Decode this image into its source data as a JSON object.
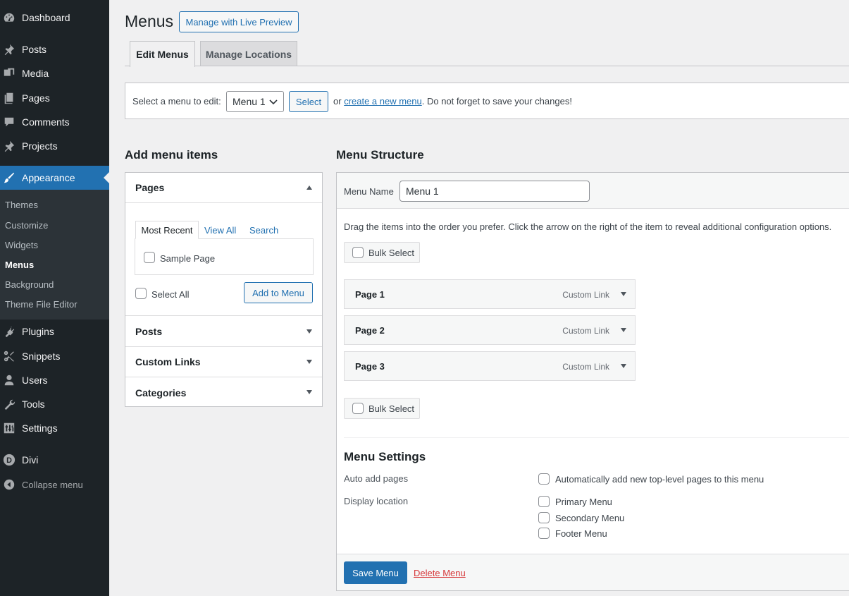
{
  "sidebar": {
    "items": [
      {
        "label": "Dashboard",
        "icon": "dashboard-icon"
      },
      {
        "label": "Posts",
        "icon": "pin-icon"
      },
      {
        "label": "Media",
        "icon": "media-icon"
      },
      {
        "label": "Pages",
        "icon": "pages-icon"
      },
      {
        "label": "Comments",
        "icon": "comment-icon"
      },
      {
        "label": "Projects",
        "icon": "pin-icon"
      },
      {
        "label": "Appearance",
        "icon": "brush-icon"
      },
      {
        "label": "Plugins",
        "icon": "plugin-icon"
      },
      {
        "label": "Snippets",
        "icon": "scissors-icon"
      },
      {
        "label": "Users",
        "icon": "user-icon"
      },
      {
        "label": "Tools",
        "icon": "wrench-icon"
      },
      {
        "label": "Settings",
        "icon": "settings-icon"
      },
      {
        "label": "Divi",
        "icon": "divi-icon"
      }
    ],
    "submenu": [
      "Themes",
      "Customize",
      "Widgets",
      "Menus",
      "Background",
      "Theme File Editor"
    ],
    "collapse_label": "Collapse menu",
    "accent_color": "#2271b1"
  },
  "header": {
    "title": "Menus",
    "live_preview": "Manage with Live Preview",
    "tabs": [
      "Edit Menus",
      "Manage Locations"
    ]
  },
  "select_bar": {
    "label": "Select a menu to edit:",
    "selected": "Menu 1",
    "button": "Select",
    "or_text": "or",
    "create_link": "create a new menu",
    "tail_text": ". Do not forget to save your changes!"
  },
  "add_items": {
    "title": "Add menu items",
    "sections": [
      "Pages",
      "Posts",
      "Custom Links",
      "Categories"
    ],
    "pages_tabs": [
      "Most Recent",
      "View All",
      "Search"
    ],
    "pages_list": [
      "Sample Page"
    ],
    "select_all": "Select All",
    "add_button": "Add to Menu"
  },
  "structure": {
    "title": "Menu Structure",
    "name_label": "Menu Name",
    "name_value": "Menu 1",
    "instructions": "Drag the items into the order you prefer. Click the arrow on the right of the item to reveal additional configuration options.",
    "bulk_select": "Bulk Select",
    "items": [
      {
        "title": "Page 1",
        "type": "Custom Link"
      },
      {
        "title": "Page 2",
        "type": "Custom Link"
      },
      {
        "title": "Page 3",
        "type": "Custom Link"
      }
    ],
    "settings_title": "Menu Settings",
    "auto_add_label": "Auto add pages",
    "auto_add_option": "Automatically add new top-level pages to this menu",
    "display_label": "Display location",
    "locations": [
      "Primary Menu",
      "Secondary Menu",
      "Footer Menu"
    ],
    "save_button": "Save Menu",
    "delete_link": "Delete Menu"
  }
}
